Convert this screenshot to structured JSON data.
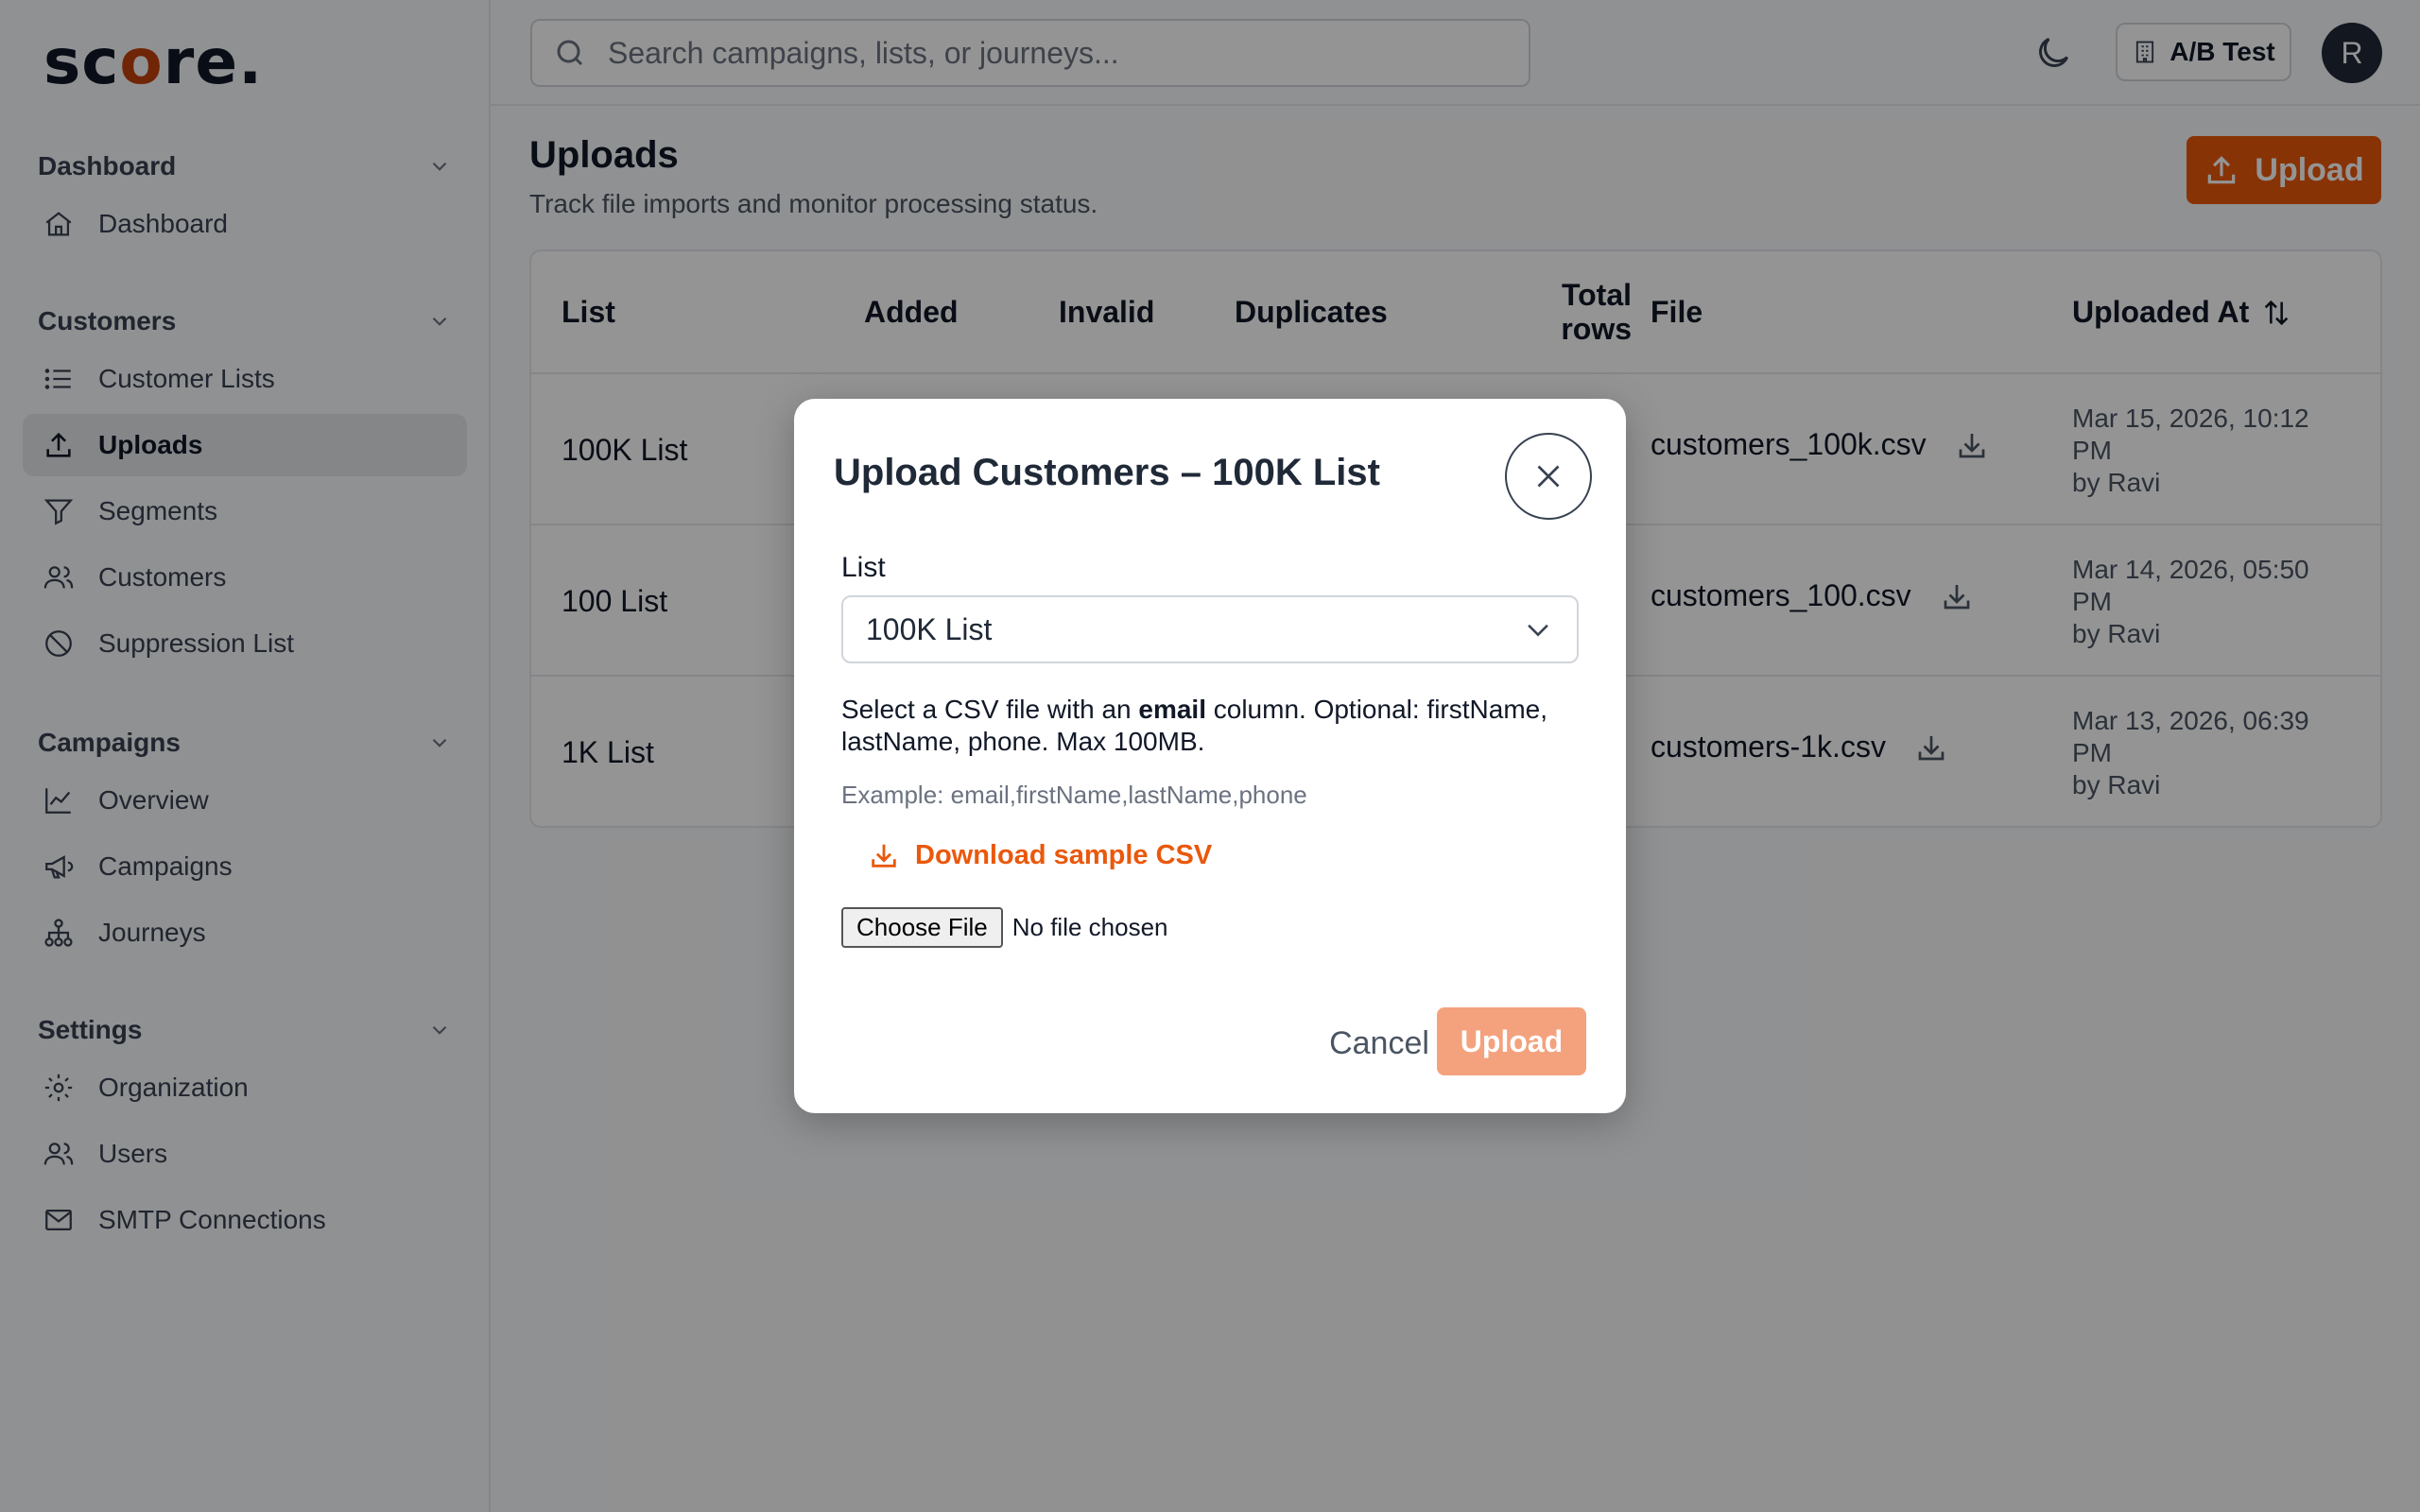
{
  "brand": {
    "prefix": "sc",
    "o": "o",
    "suffix": "re."
  },
  "sidebar": {
    "sections": [
      {
        "title": "Dashboard",
        "items": [
          {
            "label": "Dashboard",
            "icon": "home-icon"
          }
        ]
      },
      {
        "title": "Customers",
        "items": [
          {
            "label": "Customer Lists",
            "icon": "list-icon"
          },
          {
            "label": "Uploads",
            "icon": "upload-icon",
            "active": true
          },
          {
            "label": "Segments",
            "icon": "filter-icon"
          },
          {
            "label": "Customers",
            "icon": "users-icon"
          },
          {
            "label": "Suppression List",
            "icon": "ban-icon"
          }
        ]
      },
      {
        "title": "Campaigns",
        "items": [
          {
            "label": "Overview",
            "icon": "chart-line-icon"
          },
          {
            "label": "Campaigns",
            "icon": "megaphone-icon"
          },
          {
            "label": "Journeys",
            "icon": "hierarchy-icon"
          }
        ]
      },
      {
        "title": "Settings",
        "items": [
          {
            "label": "Organization",
            "icon": "gear-icon"
          },
          {
            "label": "Users",
            "icon": "users-icon"
          },
          {
            "label": "SMTP Connections",
            "icon": "mail-icon"
          }
        ]
      }
    ]
  },
  "topbar": {
    "search_placeholder": "Search campaigns, lists, or journeys...",
    "org_label": "A/B Test",
    "avatar_initial": "R"
  },
  "page": {
    "title": "Uploads",
    "subtitle": "Track file imports and monitor processing status.",
    "upload_button": "Upload"
  },
  "table": {
    "headers": {
      "list": "List",
      "added": "Added",
      "invalid": "Invalid",
      "duplicates": "Duplicates",
      "total_line1": "Total",
      "total_line2": "rows",
      "file": "File",
      "uploaded_at": "Uploaded At"
    },
    "rows": [
      {
        "list": "100K List",
        "file": "customers_100k.csv",
        "date_line1": "Mar 15, 2026, 10:12",
        "date_line2": "PM",
        "by": "by Ravi"
      },
      {
        "list": "100 List",
        "file": "customers_100.csv",
        "date_line1": "Mar 14, 2026, 05:50",
        "date_line2": "PM",
        "by": "by Ravi"
      },
      {
        "list": "1K List",
        "file": "customers-1k.csv",
        "date_line1": "Mar 13, 2026, 06:39",
        "date_line2": "PM",
        "by": "by Ravi"
      }
    ]
  },
  "modal": {
    "title": "Upload Customers – 100K List",
    "field_label": "List",
    "selected_list": "100K List",
    "help_pre": "Select a CSV file with an ",
    "help_bold": "email",
    "help_post": " column. Optional: firstName, lastName, phone. Max 100MB.",
    "example": "Example: email,firstName,lastName,phone",
    "download_link": "Download sample CSV",
    "choose_file": "Choose File",
    "no_file": "No file chosen",
    "cancel": "Cancel",
    "upload": "Upload"
  },
  "colors": {
    "accent": "#ea580c",
    "accent_disabled": "#f4a27e"
  }
}
